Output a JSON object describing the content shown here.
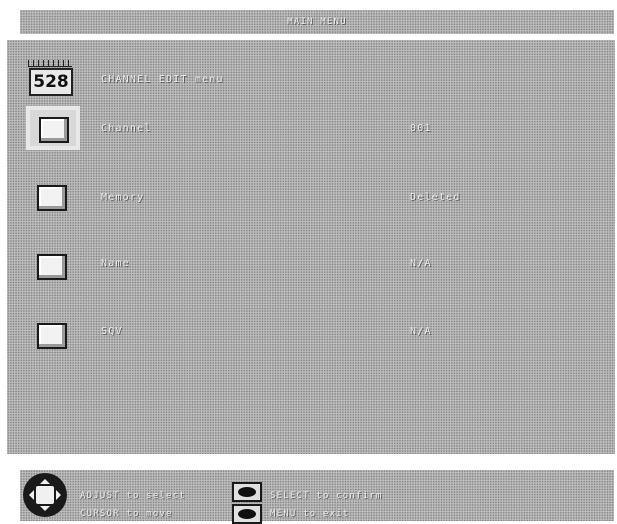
{
  "window": {
    "title": "MAIN MENU"
  },
  "header": {
    "channel_icon_digits": "528",
    "label": "CHANNEL EDIT menu"
  },
  "rows": [
    {
      "label": "Channel",
      "value": "001",
      "selected": true
    },
    {
      "label": "Memory",
      "value": "Deleted",
      "selected": false
    },
    {
      "label": "Name",
      "value": "N/A",
      "selected": false
    },
    {
      "label": "SQV",
      "value": "N/A",
      "selected": false
    }
  ],
  "footer": {
    "line1_left": "ADJUST to select",
    "line1_right": "SELECT to confirm",
    "line2_left": "CURSOR to move",
    "line2_right": "MENU to exit",
    "icons": [
      "dpad-icon",
      "ok-button-icon"
    ]
  },
  "colors": {
    "panel": "#bdbdbd",
    "text": "#ececec",
    "outline": "#1a1a1a"
  }
}
